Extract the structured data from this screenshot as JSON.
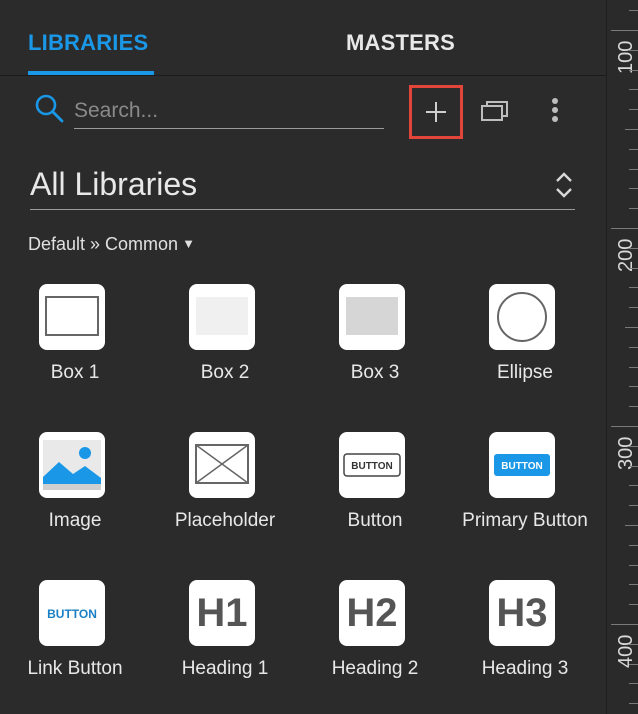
{
  "tabs": {
    "libraries": "LIBRARIES",
    "masters": "MASTERS"
  },
  "search": {
    "placeholder": "Search..."
  },
  "library_select": {
    "value": "All Libraries"
  },
  "breadcrumb": {
    "text": "Default » Common",
    "caret": "▼"
  },
  "ruler": {
    "labels": [
      "100",
      "200",
      "300",
      "400"
    ]
  },
  "colors": {
    "accent": "#1a97e6",
    "highlight": "#e2453a",
    "panel": "#2b2b2b"
  },
  "widgets": [
    {
      "label": "Box 1",
      "icon": "box1-icon"
    },
    {
      "label": "Box 2",
      "icon": "box2-icon"
    },
    {
      "label": "Box 3",
      "icon": "box3-icon"
    },
    {
      "label": "Ellipse",
      "icon": "ellipse-icon"
    },
    {
      "label": "Image",
      "icon": "image-icon"
    },
    {
      "label": "Placeholder",
      "icon": "placeholder-icon"
    },
    {
      "label": "Button",
      "icon": "button-icon",
      "text": "BUTTON"
    },
    {
      "label": "Primary Button",
      "icon": "primary-button-icon",
      "text": "BUTTON"
    },
    {
      "label": "Link Button",
      "icon": "link-button-icon",
      "text": "BUTTON"
    },
    {
      "label": "Heading 1",
      "icon": "heading1-icon",
      "text": "H1"
    },
    {
      "label": "Heading 2",
      "icon": "heading2-icon",
      "text": "H2"
    },
    {
      "label": "Heading 3",
      "icon": "heading3-icon",
      "text": "H3"
    }
  ]
}
